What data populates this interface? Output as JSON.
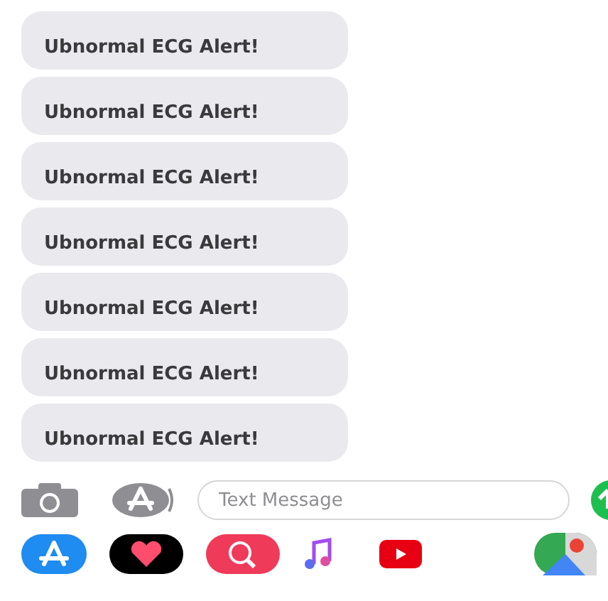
{
  "messages": [
    {
      "text": "Ubnormal ECG Alert!"
    },
    {
      "text": "Ubnormal ECG Alert!"
    },
    {
      "text": "Ubnormal ECG Alert!"
    },
    {
      "text": "Ubnormal ECG Alert!"
    },
    {
      "text": "Ubnormal ECG Alert!"
    },
    {
      "text": "Ubnormal ECG Alert!"
    },
    {
      "text": "Ubnormal ECG Alert!"
    }
  ],
  "composer": {
    "placeholder": "Text Message"
  }
}
